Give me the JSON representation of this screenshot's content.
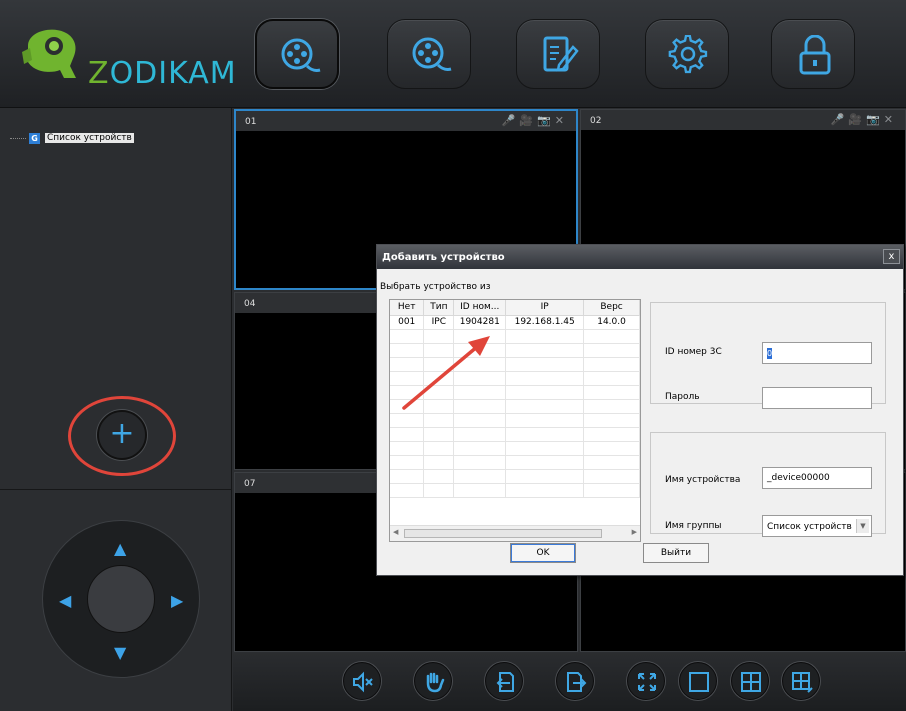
{
  "app": {
    "brand": "ZODIKAM",
    "brand_z": "Z",
    "brand_rest": "ODIKAM"
  },
  "toolbar": [
    {
      "icon": "film-reel-icon",
      "active": true
    },
    {
      "icon": "film-reel-icon",
      "active": false
    },
    {
      "icon": "edit-document-icon",
      "active": false
    },
    {
      "icon": "gear-icon",
      "active": false
    },
    {
      "icon": "lock-icon",
      "active": false
    }
  ],
  "sidebar": {
    "tree_root_badge": "G",
    "tree_root_label": "Список устройств"
  },
  "cells": [
    {
      "num": "01"
    },
    {
      "num": "02"
    },
    {
      "num": "04"
    },
    {
      "num": "07"
    }
  ],
  "bottom_toolbar": [
    "mute-icon",
    "hand-icon",
    "import-icon",
    "export-icon",
    "fullscreen-icon",
    "single-view-icon",
    "grid-4-icon",
    "grid-9-icon"
  ],
  "dialog": {
    "title": "Добавить устройство",
    "close": "x",
    "choose_from": "Выбрать устройство из",
    "columns": [
      "Нет",
      "Тип",
      "ID ном...",
      "IP",
      "Верс"
    ],
    "rows": [
      [
        "001",
        "IPC",
        "1904281",
        "192.168.1.45",
        "14.0.0"
      ]
    ],
    "id_label": "ID номер 3С",
    "id_value": "0",
    "password_label": "Пароль",
    "password_value": "",
    "device_name_label": "Имя устройства",
    "device_name_value": "_device00000",
    "group_label": "Имя группы",
    "group_value": "Список устройств",
    "ok": "OK",
    "exit": "Выйти"
  },
  "colors": {
    "accent": "#3fa7e4",
    "highlight_circle": "#e0453a",
    "annotation_arrow": "#e0453a",
    "brand_green": "#70b42f"
  }
}
